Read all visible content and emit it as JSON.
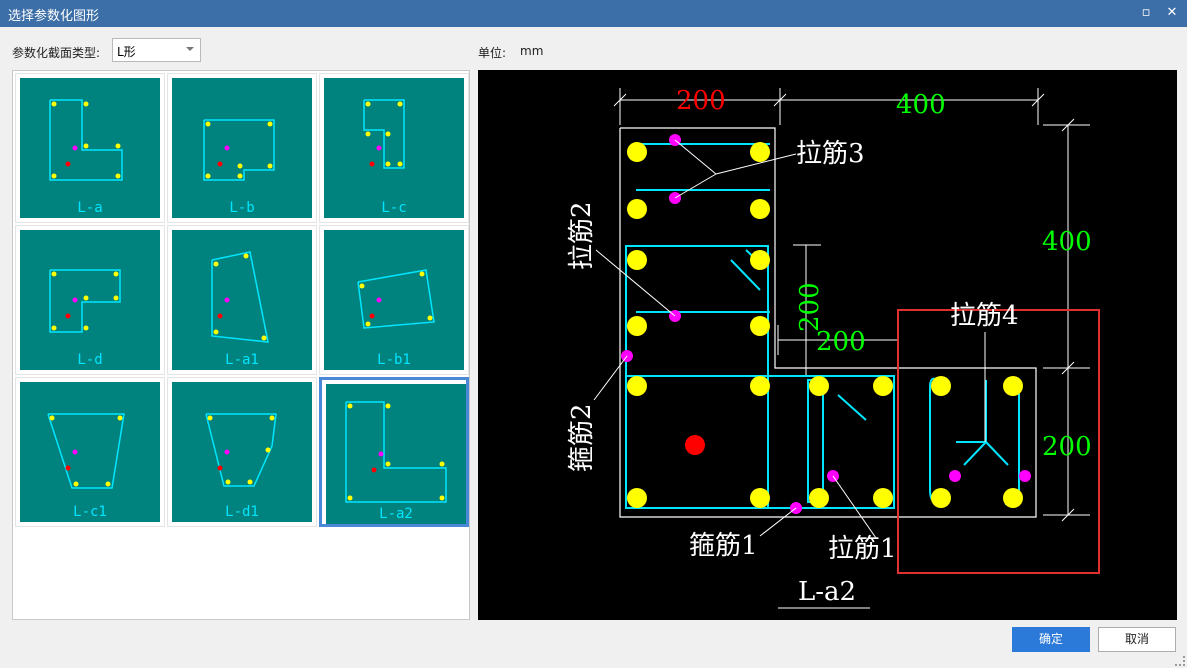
{
  "window": {
    "title": "选择参数化图形",
    "restore_icon": "▫",
    "close_icon": "✕"
  },
  "section_type": {
    "label": "参数化截面类型:",
    "value": "L形"
  },
  "unit": {
    "label": "单位:",
    "value": "mm"
  },
  "gallery": {
    "items": [
      {
        "name": "L-a",
        "selected": false
      },
      {
        "name": "L-b",
        "selected": false
      },
      {
        "name": "L-c",
        "selected": false
      },
      {
        "name": "L-d",
        "selected": false
      },
      {
        "name": "L-a1",
        "selected": false
      },
      {
        "name": "L-b1",
        "selected": false
      },
      {
        "name": "L-c1",
        "selected": false
      },
      {
        "name": "L-d1",
        "selected": false
      },
      {
        "name": "L-a2",
        "selected": true
      }
    ],
    "thumb_bg": "#00837f",
    "bar_color": "#ffff00",
    "stirrup_color": "#00e5ff",
    "tie_marker_color": "#ff00ff",
    "center_marker_color": "#ff0000"
  },
  "preview": {
    "name": "L-a2",
    "dims": {
      "top_left": "200",
      "top_right": "400",
      "right_upper": "400",
      "right_lower": "200",
      "inner_vertical": "200",
      "inner_horizontal": "200"
    },
    "labels": {
      "tie3": "拉筋3",
      "tie2": "拉筋2",
      "tie4": "拉筋4",
      "stirrup2": "箍筋2",
      "stirrup1": "箍筋1",
      "tie1": "拉筋1"
    },
    "colors": {
      "dim_red": "#ff0000",
      "dim_green": "#00ff00",
      "label": "#ffffff",
      "highlight_box": "#e03030"
    }
  },
  "buttons": {
    "ok": "确定",
    "cancel": "取消"
  }
}
